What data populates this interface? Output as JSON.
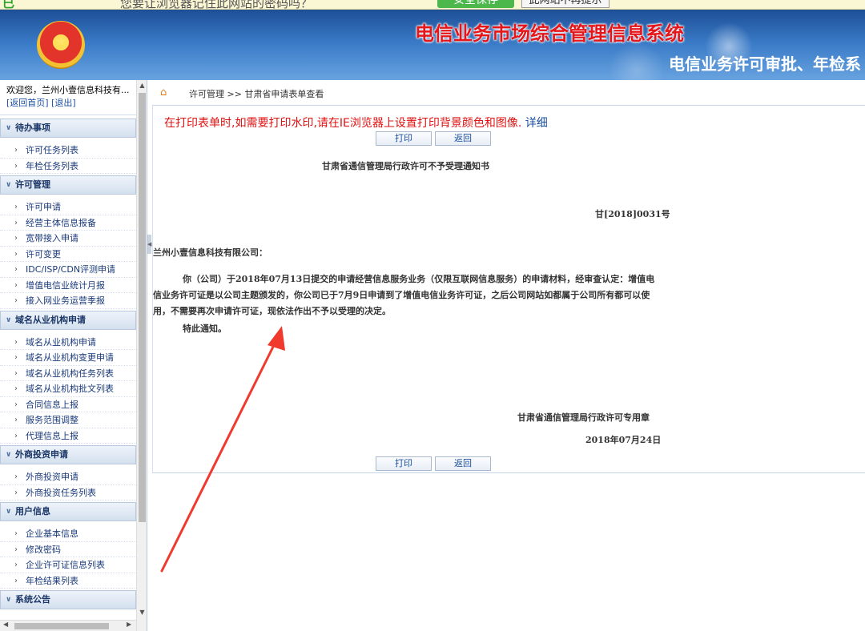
{
  "browser_bar": {
    "green_text": "已",
    "message": "您要让浏览器记住此网站的密码吗？",
    "save_button": "安全保存",
    "no_prompt_button": "此网站不再提示"
  },
  "header": {
    "title": "电信业务市场综合管理信息系统",
    "subtitle": "电信业务许可审批、年检系"
  },
  "sidebar": {
    "welcome": "欢迎您，兰州小壹信息科技有...",
    "links": [
      "[返回首页]",
      "[退出]"
    ],
    "groups": [
      {
        "title": "待办事项",
        "items": [
          "许可任务列表",
          "年检任务列表"
        ]
      },
      {
        "title": "许可管理",
        "items": [
          "许可申请",
          "经营主体信息报备",
          "宽带接入申请",
          "许可变更",
          "IDC/ISP/CDN评测申请",
          "增值电信业统计月报",
          "接入网业务运营季报"
        ]
      },
      {
        "title": "域名从业机构申请",
        "items": [
          "域名从业机构申请",
          "域名从业机构变更申请",
          "域名从业机构任务列表",
          "域名从业机构批文列表",
          "合同信息上报",
          "服务范围调整",
          "代理信息上报"
        ]
      },
      {
        "title": "外商投资申请",
        "items": [
          "外商投资申请",
          "外商投资任务列表"
        ]
      },
      {
        "title": "用户信息",
        "items": [
          "企业基本信息",
          "修改密码",
          "企业许可证信息列表",
          "年检结果列表"
        ]
      },
      {
        "title": "系统公告",
        "items": []
      }
    ]
  },
  "breadcrumb": "许可管理 >> 甘肃省申请表单查看",
  "content": {
    "notice": "在打印表单时,如需要打印水印,请在IE浏览器上设置打印背景颜色和图像.",
    "notice_link": "详细",
    "print_button": "打印",
    "back_button": "返回",
    "doc_title": "甘肃省通信管理局行政许可不予受理通知书",
    "doc_number": "甘[2018]0031号",
    "recipient": "兰州小壹信息科技有限公司：",
    "body": "你（公司）于2018年07月13日提交的申请经营信息服务业务（仅限互联网信息服务）的申请材料，经审查认定：增值电信业务许可证是以公司主题颁发的，你公司已于7月9日申请到了增值电信业务许可证，之后公司网站如都属于公司所有都可以使用，不需要再次申请许可证，现依法作出不予以受理的决定。",
    "closing": "特此通知。",
    "seal_line": "甘肃省通信管理局行政许可专用章",
    "date": "2018年07月24日"
  },
  "colors": {
    "annotation_arrow": "#f03a2e",
    "notice_red": "#e01010",
    "header_blue": "#2f6db8",
    "title_red": "#e5161a"
  }
}
